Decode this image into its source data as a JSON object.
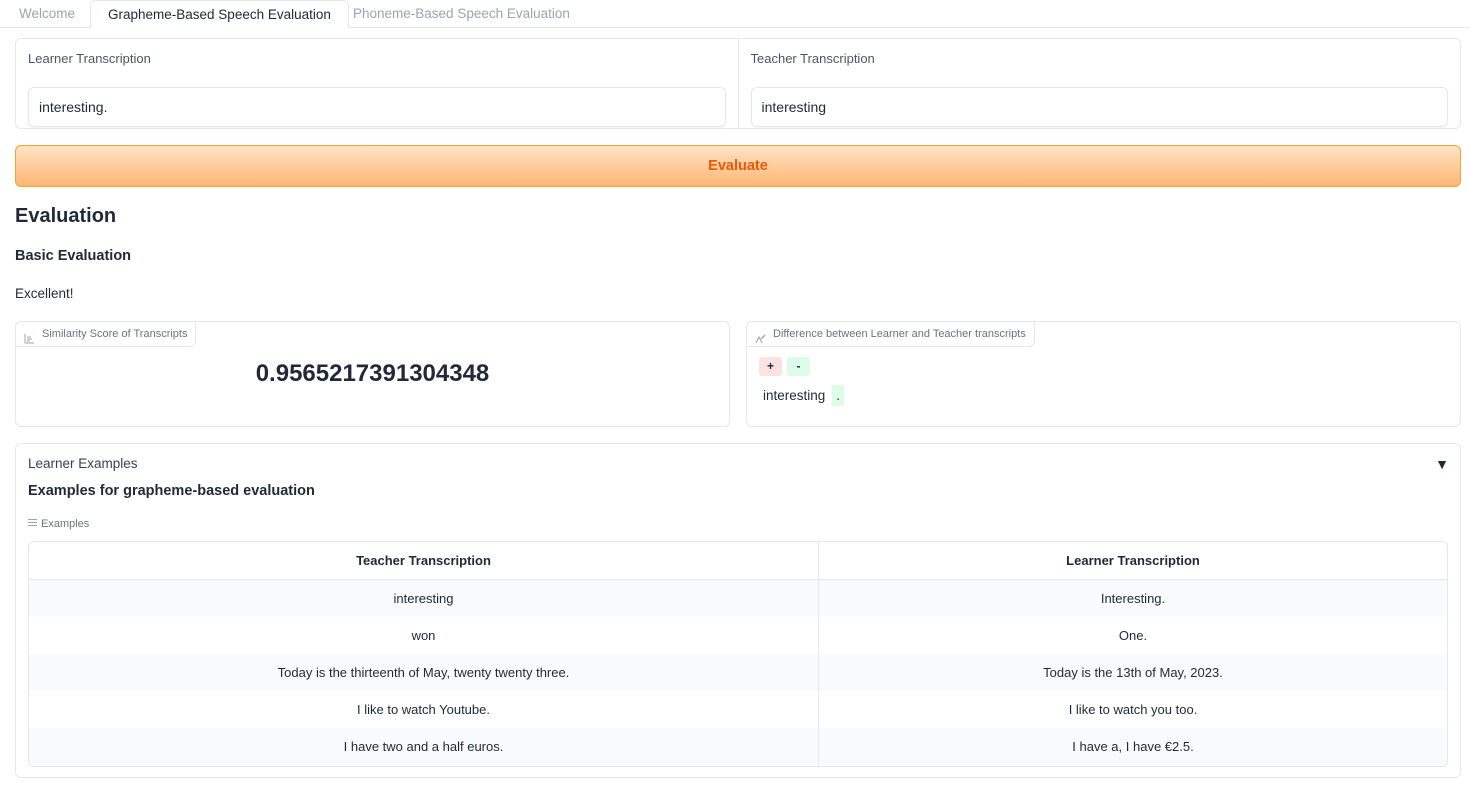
{
  "tabs": [
    {
      "label": "Welcome",
      "active": false
    },
    {
      "label": "Grapheme-Based Speech Evaluation",
      "active": true
    },
    {
      "label": "Phoneme-Based Speech Evaluation",
      "active": false
    }
  ],
  "inputs": {
    "learner_label": "Learner Transcription",
    "learner_value": "interesting.",
    "teacher_label": "Teacher Transcription",
    "teacher_value": "interesting"
  },
  "evaluate_button": "Evaluate",
  "evaluation": {
    "heading": "Evaluation",
    "basic_heading": "Basic Evaluation",
    "verdict": "Excellent!",
    "score_label": "Similarity Score of Transcripts",
    "score_value": "0.9565217391304348",
    "diff_label": "Difference between Learner and Teacher transcripts",
    "legend_plus": "+",
    "legend_minus": "-",
    "diff_word": "interesting",
    "diff_added": "."
  },
  "examples": {
    "accordion_label": "Learner Examples",
    "toggle_symbol": "▼",
    "title": "Examples for grapheme-based evaluation",
    "sub_label": "Examples",
    "columns": [
      "Teacher Transcription",
      "Learner Transcription"
    ],
    "rows": [
      [
        "interesting",
        "Interesting."
      ],
      [
        "won",
        "One."
      ],
      [
        "Today is the thirteenth of May, twenty twenty three.",
        "Today is the 13th of May, 2023."
      ],
      [
        "I like to watch Youtube.",
        "I like to watch you too."
      ],
      [
        "I have two and a half euros.",
        "I have a, I have €2.5."
      ]
    ]
  },
  "colors": {
    "accent": "#ea580c",
    "button_border": "#f0a62b",
    "added_bg": "#dcfce7",
    "removed_bg": "#fde2e2"
  }
}
